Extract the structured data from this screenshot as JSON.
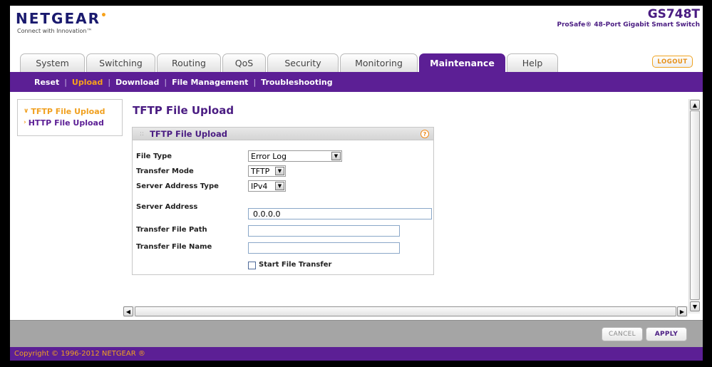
{
  "brand": {
    "logo": "NETGEAR",
    "tagline": "Connect with Innovation™",
    "model": "GS748T",
    "description": "ProSafe® 48-Port Gigabit Smart Switch"
  },
  "tabs": [
    {
      "label": "System"
    },
    {
      "label": "Switching"
    },
    {
      "label": "Routing"
    },
    {
      "label": "QoS"
    },
    {
      "label": "Security"
    },
    {
      "label": "Monitoring"
    },
    {
      "label": "Maintenance",
      "active": true
    },
    {
      "label": "Help"
    }
  ],
  "logout_label": "LOGOUT",
  "subnav": [
    {
      "label": "Reset"
    },
    {
      "label": "Upload",
      "active": true
    },
    {
      "label": "Download"
    },
    {
      "label": "File Management"
    },
    {
      "label": "Troubleshooting"
    }
  ],
  "leftnav": [
    {
      "label": "TFTP File Upload",
      "active": true
    },
    {
      "label": "HTTP File Upload"
    }
  ],
  "page_title": "TFTP File Upload",
  "panel": {
    "title": "TFTP File Upload",
    "help_glyph": "?",
    "file_type_label": "File Type",
    "file_type_value": "Error Log",
    "transfer_mode_label": "Transfer Mode",
    "transfer_mode_value": "TFTP",
    "server_address_type_label": "Server Address Type",
    "server_address_type_value": "IPv4",
    "server_address_label": "Server Address",
    "server_address_value": "0.0.0.0",
    "transfer_file_path_label": "Transfer File Path",
    "transfer_file_path_value": "",
    "transfer_file_name_label": "Transfer File Name",
    "transfer_file_name_value": "",
    "start_transfer_label": "Start File Transfer",
    "start_transfer_checked": false
  },
  "buttons": {
    "cancel": "CANCEL",
    "apply": "APPLY"
  },
  "footer": "Copyright © 1996-2012 NETGEAR ®",
  "colors": {
    "brand_purple": "#5c1f95",
    "accent_orange": "#f0a020"
  }
}
